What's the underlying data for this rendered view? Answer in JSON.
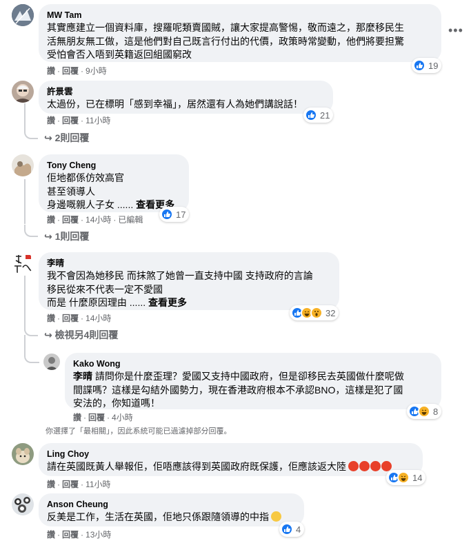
{
  "ui": {
    "like": "讚",
    "reply": "回覆",
    "edited": "已編輯",
    "see_more": "查看更多",
    "more_icon": "more-horizontal-icon"
  },
  "comments": [
    {
      "name": "MW Tam",
      "lines": [
        "其實應建立一個資料庫，搜羅呢類賣國賊，讓大家提高警惕，敬而遠之，那麼移民生",
        "活無朋友無工做，這是他們對自己既言行付出的代價，政策時常變動，他們將要担驚",
        "受怕會否入唔到英籍返回組國窮改"
      ],
      "time": "9小時",
      "reactions": [
        "like"
      ],
      "count": "19"
    },
    {
      "name": "許景雲",
      "lines": [
        "太過份，已在標明「感到幸福」，居然還有人為她們講說話！"
      ],
      "time": "11小時",
      "reactions": [
        "like"
      ],
      "count": "21",
      "replies_label": "2則回覆"
    },
    {
      "name": "Tony Cheng",
      "lines": [
        "佢地都係仿效高官",
        "甚至領導人",
        "身邊嘅親人子女 ......"
      ],
      "time": "14小時",
      "edited": true,
      "reactions": [
        "like"
      ],
      "count": "17",
      "replies_label": "1則回覆"
    },
    {
      "name": "李晴",
      "lines": [
        "我不會因為她移民 而抹煞了她曾一直支持中國 支持政府的言論",
        "移民從來不代表一定不愛國",
        "而是 什麼原因理由 ......"
      ],
      "time": "14小時",
      "reactions": [
        "like",
        "haha",
        "wow"
      ],
      "count": "32",
      "replies_label": "檢視另4則回覆"
    },
    {
      "name": "Kako Wong",
      "mention": "李晴",
      "lines": [
        " 請問你是什麼歪理？愛國又支持中國政府，但是卻移民去英國做什麼呢做",
        "間諜嗎？這樣是勾結外國勢力，現在香港政府根本不承認BNO，這樣是犯了國",
        "安法的，你知道嗎！"
      ],
      "time": "4小時",
      "reactions": [
        "like",
        "haha"
      ],
      "count": "8"
    },
    {
      "name": "Ling Choy",
      "lines": [
        "請在英國既黃人舉報佢，佢唔應該得到英國政府既保護，佢應該返大陸"
      ],
      "time": "11小時",
      "reactions": [
        "like",
        "haha"
      ],
      "count": "14"
    },
    {
      "name": "Anson Cheung",
      "lines": [
        "反美是工作，生活在英國，佢地只係跟隨領導的中指"
      ],
      "time": "13小時",
      "reactions": [
        "like"
      ],
      "count": "4"
    }
  ],
  "filter_notice": "你選擇了「最相關」，因此系統可能已過濾掉部分回覆。",
  "colors": {
    "bubble": "#f0f2f5",
    "meta": "#65676b",
    "like": "#1877f2",
    "haha": "#f7b125",
    "angry": "#e8402a"
  }
}
